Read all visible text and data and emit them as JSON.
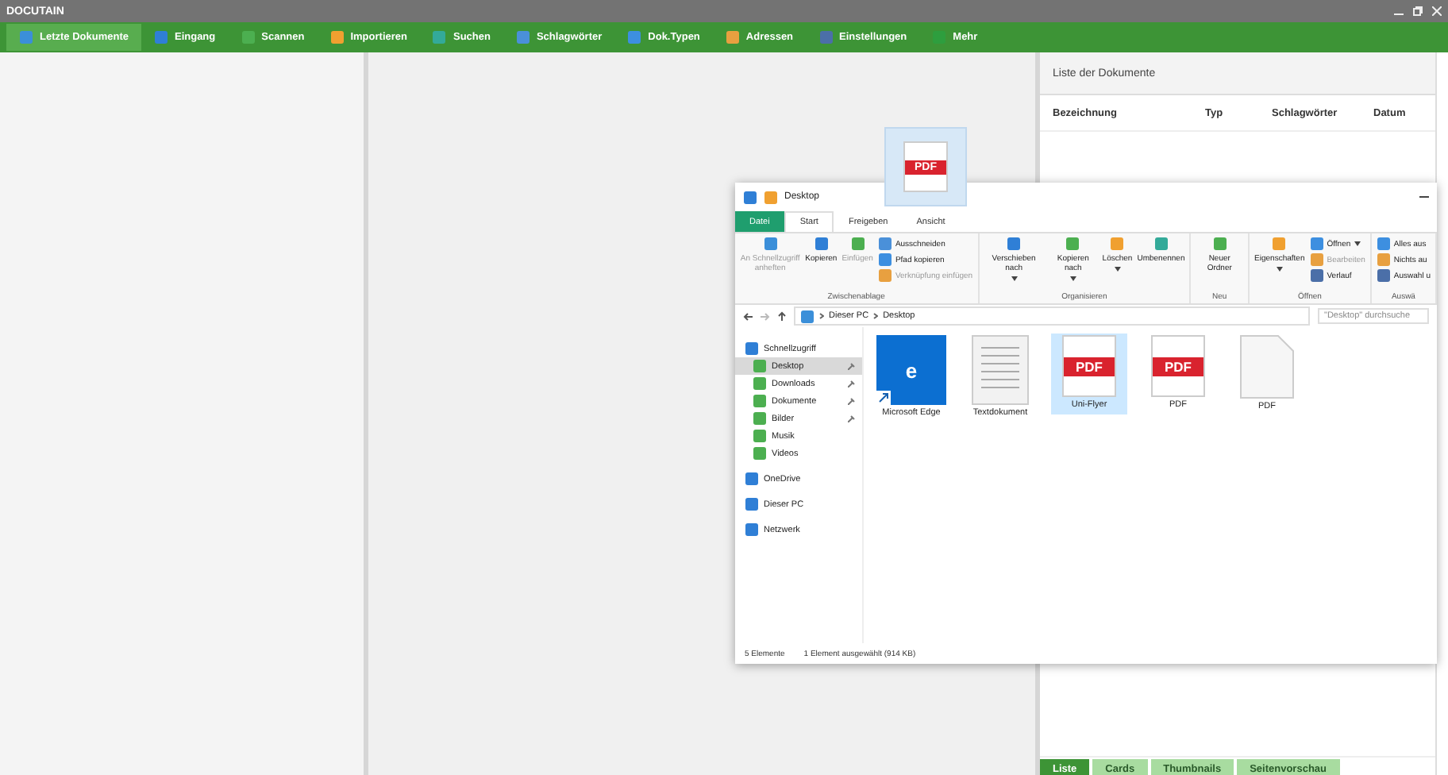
{
  "app": {
    "title": "DOCUTAIN"
  },
  "toolbar": [
    {
      "label": "Letzte Dokumente",
      "selected": true
    },
    {
      "label": "Eingang",
      "selected": false
    },
    {
      "label": "Scannen",
      "selected": false
    },
    {
      "label": "Importieren",
      "selected": false
    },
    {
      "label": "Suchen",
      "selected": false
    },
    {
      "label": "Schlagwörter",
      "selected": false
    },
    {
      "label": "Dok.Typen",
      "selected": false
    },
    {
      "label": "Adressen",
      "selected": false
    },
    {
      "label": "Einstellungen",
      "selected": false
    },
    {
      "label": "Mehr",
      "selected": false
    }
  ],
  "document_list": {
    "title": "Liste der Dokumente",
    "columns": [
      "Bezeichnung",
      "Typ",
      "Schlagwörter",
      "Datum"
    ],
    "view_tabs": [
      {
        "label": "Liste",
        "selected": true
      },
      {
        "label": "Cards",
        "selected": false
      },
      {
        "label": "Thumbnails",
        "selected": false
      },
      {
        "label": "Seitenvorschau",
        "selected": false
      }
    ]
  },
  "drag_preview": {
    "badge": "PDF"
  },
  "explorer": {
    "title": "Desktop",
    "ribbon_tabs": [
      {
        "label": "Datei",
        "kind": "file",
        "selected": false
      },
      {
        "label": "Start",
        "kind": "tab",
        "selected": true
      },
      {
        "label": "Freigeben",
        "kind": "tab",
        "selected": false
      },
      {
        "label": "Ansicht",
        "kind": "tab",
        "selected": false
      }
    ],
    "ribbon_groups": [
      {
        "label": "Zwischenablage",
        "items": [
          {
            "label": "An Schnellzugriff anheften",
            "kind": "large",
            "disabled": true,
            "dropdown": false
          },
          {
            "label": "Kopieren",
            "kind": "large",
            "disabled": false,
            "dropdown": false
          },
          {
            "label": "Einfügen",
            "kind": "large",
            "disabled": true,
            "dropdown": false
          },
          {
            "label": "Ausschneiden",
            "kind": "small",
            "disabled": false,
            "dropdown": false
          },
          {
            "label": "Pfad kopieren",
            "kind": "small",
            "disabled": false,
            "dropdown": false
          },
          {
            "label": "Verknüpfung einfügen",
            "kind": "small",
            "disabled": true,
            "dropdown": false
          }
        ]
      },
      {
        "label": "Organisieren",
        "items": [
          {
            "label": "Verschieben nach",
            "kind": "large",
            "disabled": false,
            "dropdown": true
          },
          {
            "label": "Kopieren nach",
            "kind": "large",
            "disabled": false,
            "dropdown": true
          },
          {
            "label": "Löschen",
            "kind": "large",
            "disabled": false,
            "dropdown": true
          },
          {
            "label": "Umbenennen",
            "kind": "large",
            "disabled": false,
            "dropdown": false
          }
        ]
      },
      {
        "label": "Neu",
        "items": [
          {
            "label": "Neuer Ordner",
            "kind": "large",
            "disabled": false,
            "dropdown": false
          }
        ]
      },
      {
        "label": "Öffnen",
        "items": [
          {
            "label": "Eigenschaften",
            "kind": "large",
            "disabled": false,
            "dropdown": true
          },
          {
            "label": "Öffnen",
            "kind": "small",
            "disabled": false,
            "dropdown": true
          },
          {
            "label": "Bearbeiten",
            "kind": "small",
            "disabled": true,
            "dropdown": false
          },
          {
            "label": "Verlauf",
            "kind": "small",
            "disabled": false,
            "dropdown": false
          }
        ]
      },
      {
        "label": "Auswä",
        "items": [
          {
            "label": "Alles aus",
            "kind": "small",
            "disabled": false,
            "dropdown": false
          },
          {
            "label": "Nichts au",
            "kind": "small",
            "disabled": false,
            "dropdown": false
          },
          {
            "label": "Auswahl u",
            "kind": "small",
            "disabled": false,
            "dropdown": false
          }
        ]
      }
    ],
    "path": [
      "Dieser PC",
      "Desktop"
    ],
    "search": {
      "placeholder": "\"Desktop\" durchsuche"
    },
    "nav": [
      {
        "label": "Schnellzugriff",
        "selected": false,
        "pinned": false,
        "children": [
          {
            "label": "Desktop",
            "selected": true,
            "pinned": true
          },
          {
            "label": "Downloads",
            "selected": false,
            "pinned": true
          },
          {
            "label": "Dokumente",
            "selected": false,
            "pinned": true
          },
          {
            "label": "Bilder",
            "selected": false,
            "pinned": true
          },
          {
            "label": "Musik",
            "selected": false,
            "pinned": false
          },
          {
            "label": "Videos",
            "selected": false,
            "pinned": false
          }
        ]
      },
      {
        "label": "OneDrive",
        "selected": false,
        "pinned": false
      },
      {
        "label": "Dieser PC",
        "selected": false,
        "pinned": false
      },
      {
        "label": "Netzwerk",
        "selected": false,
        "pinned": false
      }
    ],
    "files": [
      {
        "name": "Microsoft Edge",
        "kind": "shortcut",
        "badge": "e",
        "selected": false
      },
      {
        "name": "Textdokument",
        "kind": "text",
        "selected": false
      },
      {
        "name": "Uni-Flyer",
        "kind": "pdf",
        "badge": "PDF",
        "selected": true
      },
      {
        "name": "PDF",
        "kind": "pdf",
        "badge": "PDF",
        "selected": false
      },
      {
        "name": "PDF",
        "kind": "blank",
        "selected": false
      }
    ],
    "status": [
      "5 Elemente",
      "1 Element ausgewählt (914 KB)"
    ]
  }
}
